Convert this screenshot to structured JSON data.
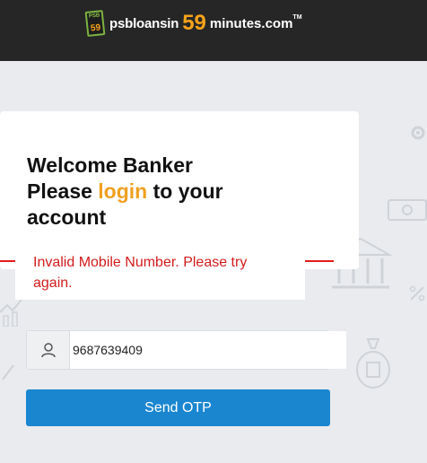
{
  "header": {
    "logo_badge_top": "PSB",
    "logo_badge_num": "59",
    "logo_text_part1": "psbloansin",
    "logo_text_num": "59",
    "logo_text_part2": "minutes.com",
    "logo_tm": "TM"
  },
  "card": {
    "title_line1": "Welcome Banker",
    "title_line2_before": "Please ",
    "title_line2_highlight": "login",
    "title_line2_after": " to your",
    "title_line3": "account"
  },
  "error": {
    "message": "Invalid Mobile Number. Please try again."
  },
  "form": {
    "mobile_value": "9687639409",
    "mobile_icon": "user-icon",
    "send_label": "Send OTP"
  },
  "colors": {
    "header_bg": "#262626",
    "accent_orange": "#f7a21b",
    "error_red": "#d21c1c",
    "button_blue": "#1a86d0"
  }
}
